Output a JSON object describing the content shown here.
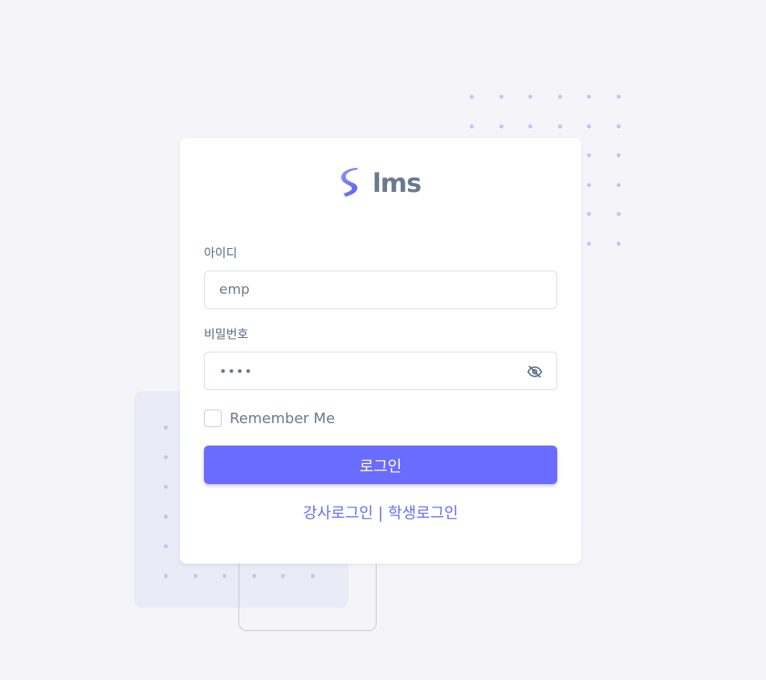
{
  "brand": {
    "name": "lms",
    "logo_icon": "lms-logo-icon"
  },
  "form": {
    "id_label": "아이디",
    "id_value": "emp",
    "password_label": "비밀번호",
    "password_value": "••••",
    "password_toggle_icon": "eye-off-icon",
    "remember_label": "Remember Me",
    "remember_checked": false,
    "login_button": "로그인"
  },
  "links": {
    "teacher_login": "강사로그인",
    "separator": "|",
    "student_login": "학생로그인"
  },
  "colors": {
    "accent": "#696cff",
    "background": "#f5f5f9",
    "text": "#697a8d"
  }
}
